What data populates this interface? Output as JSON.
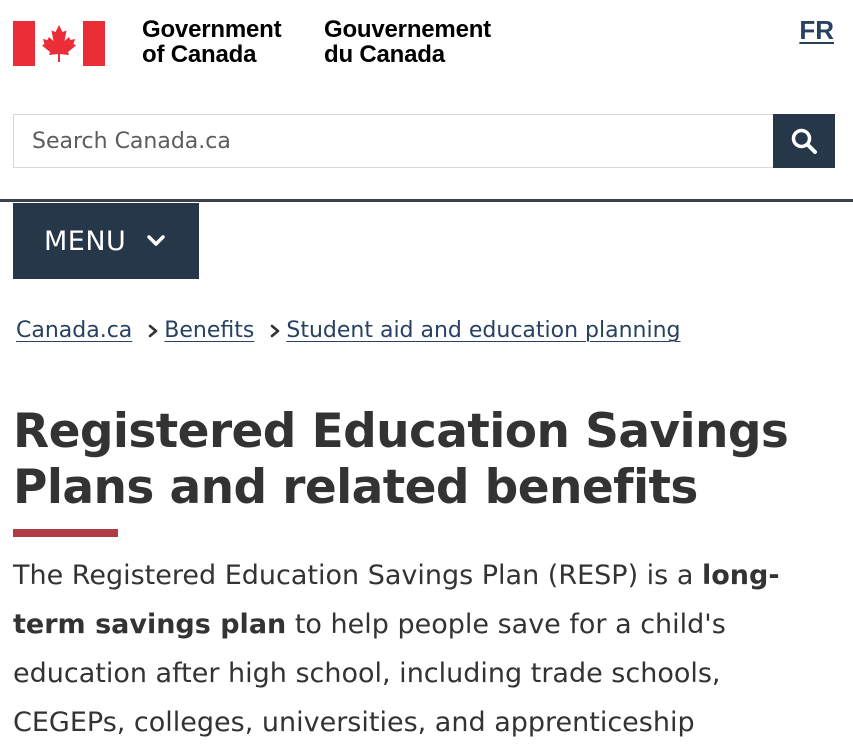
{
  "header": {
    "signature_en": [
      "Government",
      "of Canada"
    ],
    "signature_fr": [
      "Gouvernement",
      "du Canada"
    ],
    "language_toggle": "FR",
    "flag_icon": "canada-flag-icon",
    "flag_color": "#eb2d37"
  },
  "search": {
    "placeholder": "Search Canada.ca",
    "button_icon": "search-icon"
  },
  "menu": {
    "label": "MENU",
    "icon": "chevron-down-icon"
  },
  "breadcrumb": [
    "Canada.ca",
    "Benefits",
    "Student aid and education planning"
  ],
  "page": {
    "title": "Registered Education Savings Plans and related benefits",
    "intro_parts": {
      "before": "The Registered Education Savings Plan (RESP) is a ",
      "bold": "long-term savings plan",
      "after": " to help people save for a child's education after high school, including trade schools, CEGEPs, colleges, universities, and apprenticeship"
    }
  },
  "colors": {
    "primary_dark": "#26374a",
    "link": "#284162",
    "accent_red": "#af3c43"
  }
}
